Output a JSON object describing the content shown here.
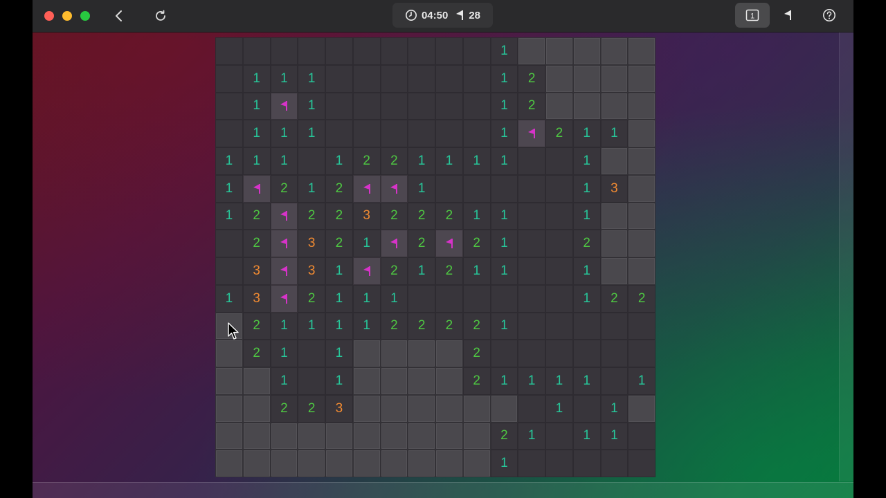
{
  "toolbar": {
    "timer": "04:50",
    "flags_remaining": "28",
    "layout_badge": "1",
    "icons": [
      "close-button",
      "minimize-button",
      "zoom-button",
      "back-icon",
      "reload-icon",
      "clock-icon",
      "flag-icon",
      "board-size-icon",
      "flag-mode-icon",
      "help-icon"
    ]
  },
  "colors": {
    "n1": "#27c79a",
    "n2": "#4ec742",
    "n3": "#f08a32",
    "flag": "#d633c8"
  },
  "board": {
    "rows": 16,
    "cols": 16,
    "legend": "'.' revealed empty, '#' hidden, 'F' flagged, digits = adjacent mines",
    "grid": [
      "..........1#####",
      ".111......12####",
      ".1F1......12####",
      ".111......1F211#",
      "111.1221111..1##",
      "1F212FF1.....13#",
      "12F22322211..1##",
      ".2F321F2F21..2##",
      ".3F31F21211..1##",
      "13F2111......122",
      "#2111122221.....",
      "#21.1####2......",
      "##1.1####21111.11",
      "##223######.1.1#",
      "##########21.11.",
      "##########1....."
    ]
  }
}
